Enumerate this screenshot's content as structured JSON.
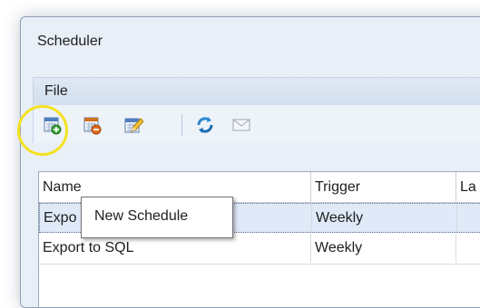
{
  "window": {
    "title": "Scheduler"
  },
  "menu": {
    "items": [
      {
        "label": "File"
      }
    ]
  },
  "toolbar": {
    "buttons": [
      {
        "name": "new-schedule-button",
        "icon": "calendar-add-icon"
      },
      {
        "name": "delete-schedule-button",
        "icon": "calendar-remove-icon"
      },
      {
        "name": "edit-schedule-button",
        "icon": "calendar-edit-icon"
      },
      {
        "name": "refresh-button",
        "icon": "refresh-icon"
      },
      {
        "name": "email-button",
        "icon": "envelope-icon"
      }
    ],
    "highlight_color": "#f3e221"
  },
  "tooltip": {
    "text": "New Schedule"
  },
  "table": {
    "columns": [
      {
        "label": "Name"
      },
      {
        "label": "Trigger"
      },
      {
        "label": "La"
      }
    ],
    "rows": [
      {
        "name": "Expo",
        "trigger": "Weekly",
        "last": "",
        "selected": true
      },
      {
        "name": "Export to SQL",
        "trigger": "Weekly",
        "last": "",
        "selected": false
      }
    ]
  }
}
